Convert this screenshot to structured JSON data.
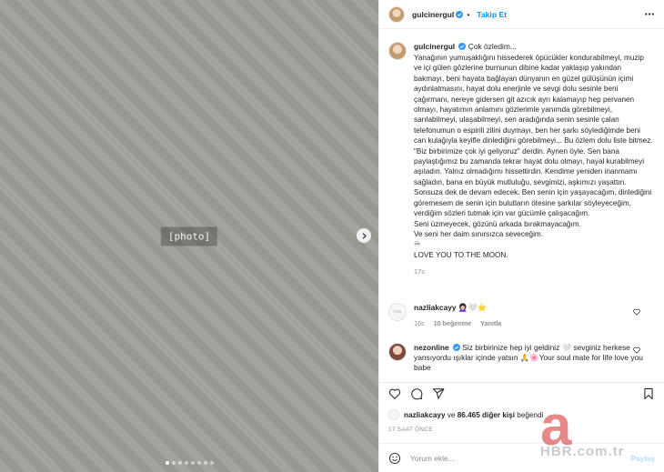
{
  "photo": {
    "placeholder_label": "[photo]",
    "slide_count": 8,
    "active_slide": 1
  },
  "header": {
    "username": "gulcinergul",
    "separator": "•",
    "follow_label": "Takip Et",
    "more_icon": "more-horizontal-icon"
  },
  "caption": {
    "username": "gulcinergul",
    "first_line": "Çok özledim...",
    "text": "Yanağının yumuşaklığını hissederek öpücükler kondurabilmeyi, muzip ve içi gülen gözlerine burnunun dibine kadar yaklaşıp yakından bakmayı, beni hayata bağlayan dünyanın en güzel gülüşünün içimi aydınlatmasını, hayat dolu enerjinle ve sevgi dolu sesinle beni çağırmanı, nereye gidersen git azıcık ayrı kalamayıp hep pervanen olmayı, hayatımın anlamını gözlerimle yanımda görebilmeyi, sarılabilmeyi, ulaşabilmeyi, sen aradığında senin sesinle çalan telefonumun o espirili zilini duymayı, ben her şarkı söylediğimde beni can kulağıyla keyifle dinlediğini görebilmeyi... Bu özlem dolu liste bitmez. \"Biz birbirimize çok iyi geliyoruz\" derdin. Aynen öyle. Sen bana paylaştığımız bu zamanda tekrar hayat dolu olmayı, hayal kurabilmeyi aşıladın. Yalnız olmadığımı hissettirdin. Kendime yeniden inanmamı sağladın, bana en büyük mutluluğu, sevgimizi, aşkımızı yaşattın. Sonsuza dek de devam edecek. Ben senin için yaşayacağım, dinlediğini göremesem de senin için bulutların ötesine şarkılar söyleyeceğim, verdiğim sözleri tutmak için var gücümle çalışacağım.\nSeni üzmeyecek, gözünü arkada bırakmayacağım.\nVe seni her daim sınırsızca seveceğim.\n♾\nLOVE YOU TO THE MOON.",
    "age": "17s"
  },
  "comments": [
    {
      "username": "nazliakcayy",
      "avatar_label": "nox",
      "text": "👩🏻‍🦱🤍⭐",
      "age": "16s",
      "likes": "10 beğenme",
      "reply_label": "Yanıtla"
    },
    {
      "username": "nezonline",
      "text": "Siz birbirinize hep iyi geldiniz 🤍 sevginiz herkese yansıyordu ışıklar içinde yatsın 🙏🌸Your soul mate for life love you babe"
    }
  ],
  "likes": {
    "user": "nazliakcayy",
    "connector": " ve ",
    "count": "86.465 diğer kişi",
    "suffix": " beğendi"
  },
  "timestamp": "17 SAAT ÖNCE",
  "comment_box": {
    "placeholder": "Yorum ekle...",
    "submit_label": "Paylaş"
  },
  "watermark": {
    "logo_letter": "a",
    "text": "HBR.com.tr"
  },
  "colors": {
    "accent_blue": "#0095f6",
    "disabled_blue": "#b2dffc",
    "verified_blue": "#3897f0",
    "muted_text": "#8e8e8e"
  }
}
